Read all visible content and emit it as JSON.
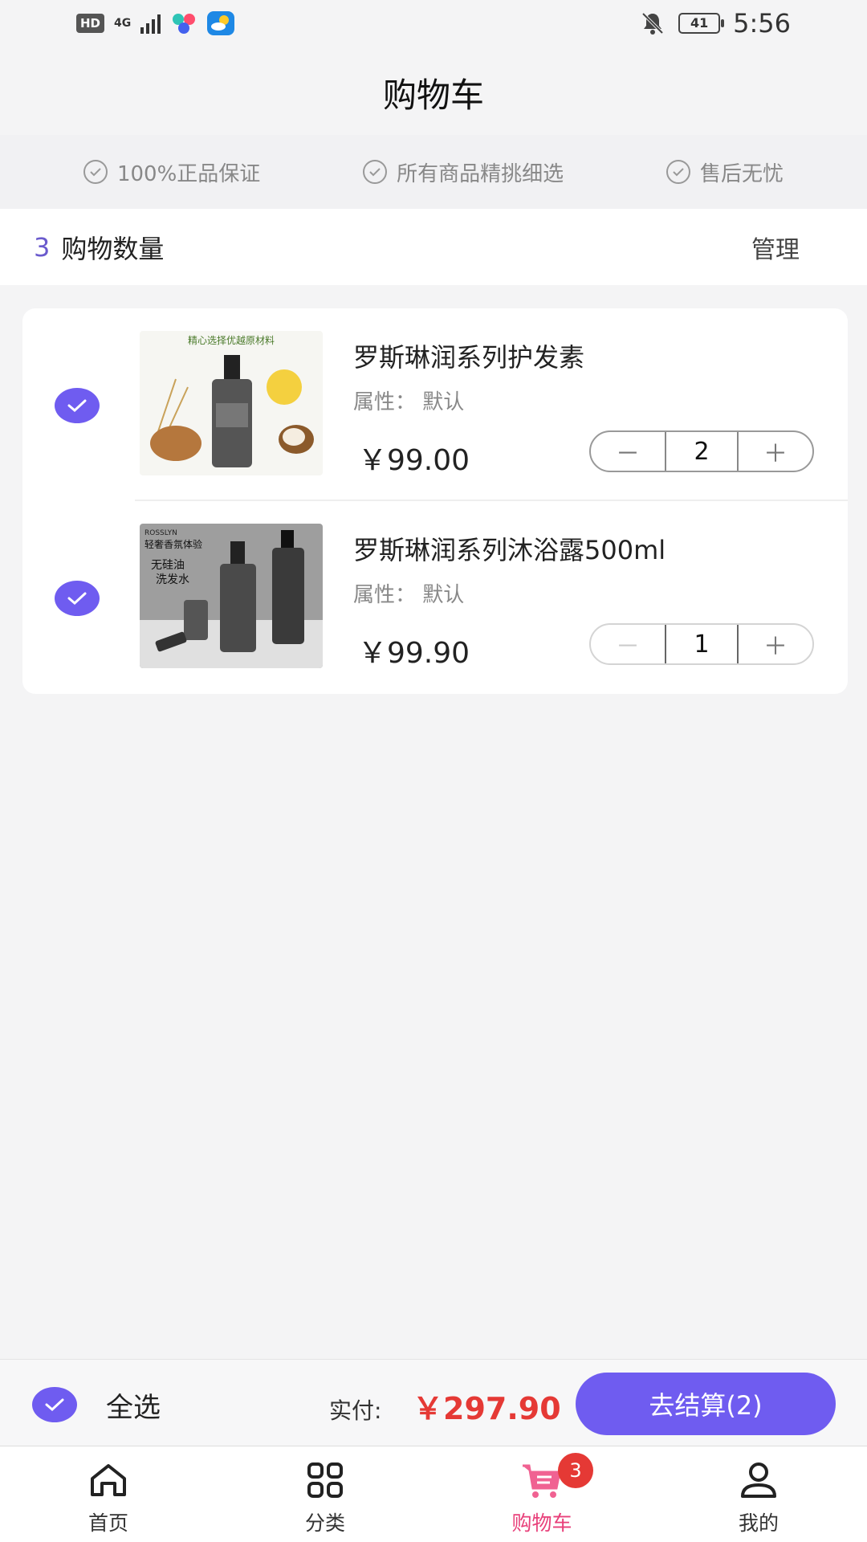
{
  "status_bar": {
    "hd": "HD",
    "network": "4G",
    "battery": "41",
    "time": "5:56"
  },
  "header": {
    "title": "购物车"
  },
  "guarantees": [
    {
      "label": "100%正品保证",
      "icon": "check-circle-icon"
    },
    {
      "label": "所有商品精挑细选",
      "icon": "check-circle-icon"
    },
    {
      "label": "售后无忧",
      "icon": "check-circle-icon"
    }
  ],
  "cart_summary": {
    "count": "3",
    "count_label": "购物数量",
    "manage_label": "管理"
  },
  "items": [
    {
      "name": "罗斯琳润系列护发素",
      "attr_label": "属性：",
      "attr_value": "默认",
      "price": "￥99.00",
      "quantity": "2",
      "minus": "－",
      "plus": "＋",
      "selected": true
    },
    {
      "name": "罗斯琳润系列沐浴露500ml",
      "attr_label": "属性：",
      "attr_value": "默认",
      "price": "￥99.90",
      "quantity": "1",
      "minus": "－",
      "plus": "＋",
      "selected": true
    }
  ],
  "product_images": {
    "img1_banner": "精心选择优越原材料",
    "img2_line1": "轻奢香氛体验",
    "img2_line2": "无硅油",
    "img2_line3": "洗发水",
    "img2_brand": "ROSSLYN"
  },
  "checkout": {
    "select_all_label": "全选",
    "pay_label": "实付:",
    "total": "￥297.90",
    "button_label": "去结算(2)"
  },
  "tabs": [
    {
      "label": "首页",
      "icon": "home-icon"
    },
    {
      "label": "分类",
      "icon": "category-icon"
    },
    {
      "label": "购物车",
      "icon": "cart-icon",
      "badge": "3",
      "active": true
    },
    {
      "label": "我的",
      "icon": "user-icon"
    }
  ],
  "colors": {
    "accent": "#6f5cf0",
    "price_red": "#e53935",
    "tab_active": "#e8407a"
  }
}
